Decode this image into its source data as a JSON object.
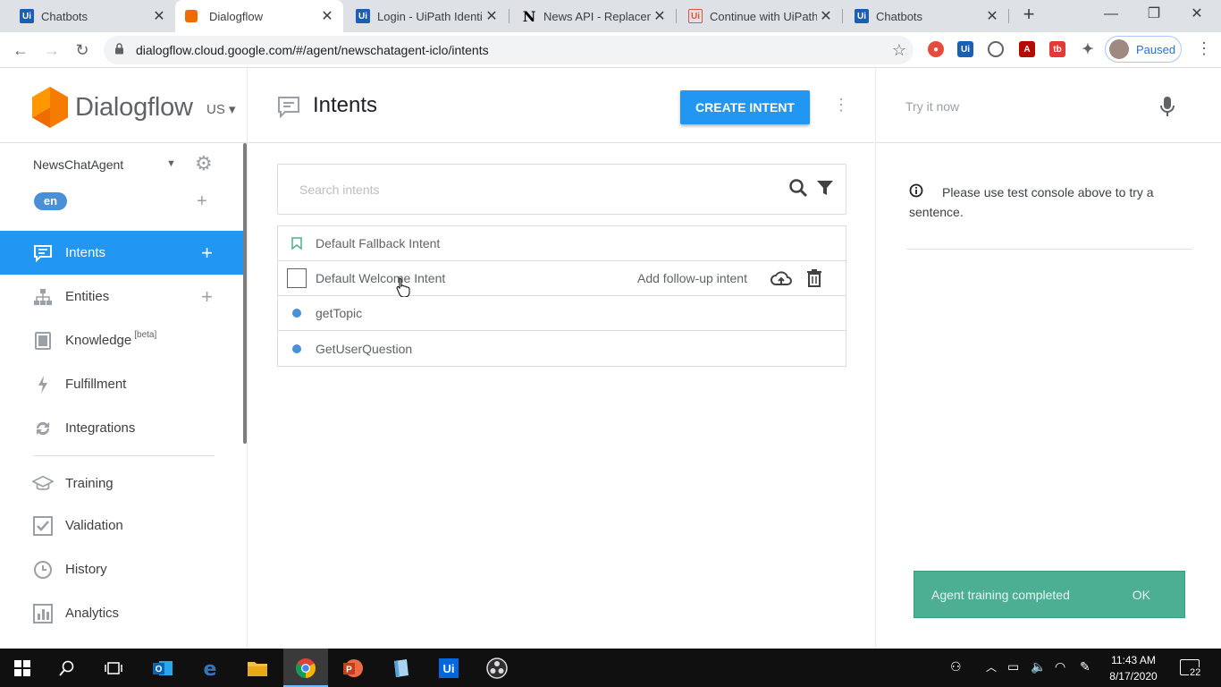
{
  "browser": {
    "tabs": [
      {
        "title": "Chatbots",
        "favicon": "uipath-icon"
      },
      {
        "title": "Dialogflow",
        "favicon": "dialogflow-icon",
        "active": true
      },
      {
        "title": "Login - UiPath Identi",
        "favicon": "uipath-icon"
      },
      {
        "title": "News API - Replacem",
        "favicon": "notion-icon"
      },
      {
        "title": "Continue with UiPath",
        "favicon": "uipath-outline-icon"
      },
      {
        "title": "Chatbots",
        "favicon": "uipath-icon"
      }
    ],
    "url": "dialogflow.cloud.google.com/#/agent/newschatagent-iclo/intents",
    "profile_label": "Paused",
    "colors": {
      "tabbar": "#dee1e6",
      "accent": "#1a73e8"
    }
  },
  "sidebar": {
    "brand": "Dialogflow",
    "region": "US",
    "agent_name": "NewsChatAgent",
    "language": "en",
    "nav": [
      {
        "label": "Intents",
        "icon": "chat-bubble-icon",
        "active": true,
        "has_add": true
      },
      {
        "label": "Entities",
        "icon": "hierarchy-icon",
        "has_add": true
      },
      {
        "label": "Knowledge",
        "icon": "book-icon",
        "badge": "[beta]"
      },
      {
        "label": "Fulfillment",
        "icon": "lightning-icon"
      },
      {
        "label": "Integrations",
        "icon": "sync-icon"
      },
      {
        "label": "Training",
        "icon": "graduation-cap-icon"
      },
      {
        "label": "Validation",
        "icon": "checkbox-icon"
      },
      {
        "label": "History",
        "icon": "clock-icon"
      },
      {
        "label": "Analytics",
        "icon": "bar-chart-icon"
      }
    ],
    "colors": {
      "active_bg": "#2196f3"
    }
  },
  "main": {
    "title": "Intents",
    "create_button": "CREATE INTENT",
    "search_placeholder": "Search intents",
    "intents": [
      {
        "name": "Default Fallback Intent",
        "marker": "bookmark"
      },
      {
        "name": "Default Welcome Intent",
        "marker": "checkbox",
        "hovered": true,
        "follow_up": "Add follow-up intent"
      },
      {
        "name": "getTopic",
        "marker": "dot"
      },
      {
        "name": "GetUserQuestion",
        "marker": "dot"
      }
    ]
  },
  "console": {
    "try_placeholder": "Try it now",
    "info": "Please use test console above to try a sentence.",
    "toast": {
      "message": "Agent training completed",
      "action": "OK"
    },
    "colors": {
      "toast_bg": "#4caf93"
    }
  },
  "taskbar": {
    "time": "11:43 AM",
    "date": "8/17/2020",
    "notifications": "22",
    "apps": [
      "windows-start-icon",
      "search-icon",
      "task-view-icon",
      "outlook-icon",
      "edge-icon",
      "file-explorer-icon",
      "chrome-icon",
      "powerpoint-icon",
      "notepad-icon",
      "uipath-icon",
      "obs-icon"
    ]
  }
}
